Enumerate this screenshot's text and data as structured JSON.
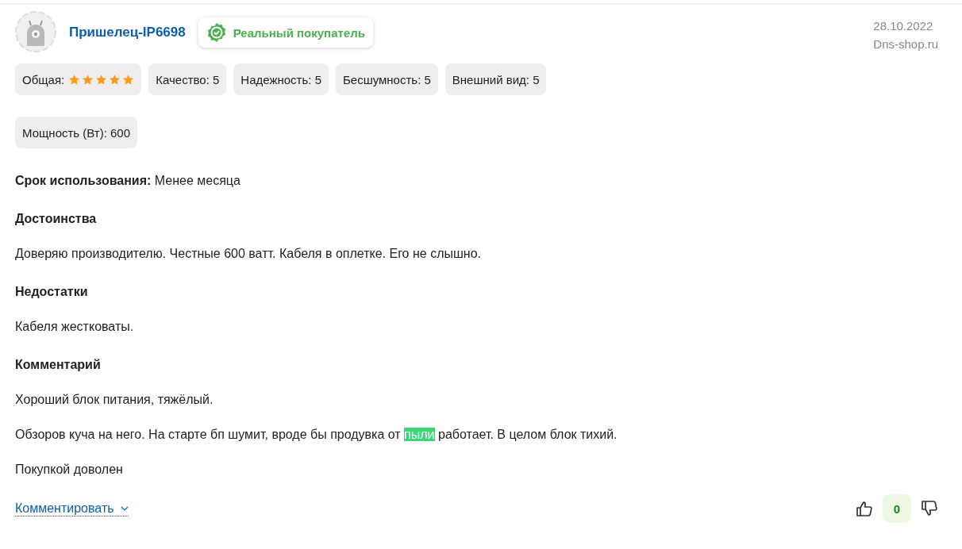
{
  "author": {
    "name": "Пришелец-IP6698",
    "badge": "Реальный покупатель"
  },
  "meta": {
    "date": "28.10.2022",
    "source": "Dns-shop.ru"
  },
  "ratings": [
    {
      "kind": "stars",
      "label": "Общая:",
      "stars": 5
    },
    {
      "kind": "text",
      "label": "Качество: 5"
    },
    {
      "kind": "text",
      "label": "Надежность: 5"
    },
    {
      "kind": "text",
      "label": "Бесшумность: 5"
    },
    {
      "kind": "text",
      "label": "Внешний вид: 5"
    }
  ],
  "extra_ratings": [
    {
      "kind": "text",
      "label": "Мощность (Вт): 600"
    }
  ],
  "usage": "**Срок использования:** Менее месяца",
  "sections": [
    {
      "title": "Достоинства",
      "paragraphs": [
        [
          {
            "text": "Доверяю производителю. Честные 600 ватт. Кабеля в оплетке. Его не слышно.",
            "highlighted": false
          }
        ]
      ]
    },
    {
      "title": "Недостатки",
      "paragraphs": [
        [
          {
            "text": "Кабеля жестковаты.",
            "highlighted": false
          }
        ]
      ]
    },
    {
      "title": "Комментарий",
      "paragraphs": [
        [
          {
            "text": "Хороший блок питания, тяжёлый.",
            "highlighted": false
          }
        ],
        [
          {
            "text": "Обзоров куча на него. На старте бп шумит, вроде бы продувка от ",
            "highlighted": false
          },
          {
            "text": "пыли",
            "highlighted": true
          },
          {
            "text": " работает. В целом блок тихий.",
            "highlighted": false
          }
        ],
        [
          {
            "text": "Покупкой доволен",
            "highlighted": false
          }
        ]
      ]
    }
  ],
  "comment_link": "Комментировать",
  "votes": {
    "count": "0"
  }
}
